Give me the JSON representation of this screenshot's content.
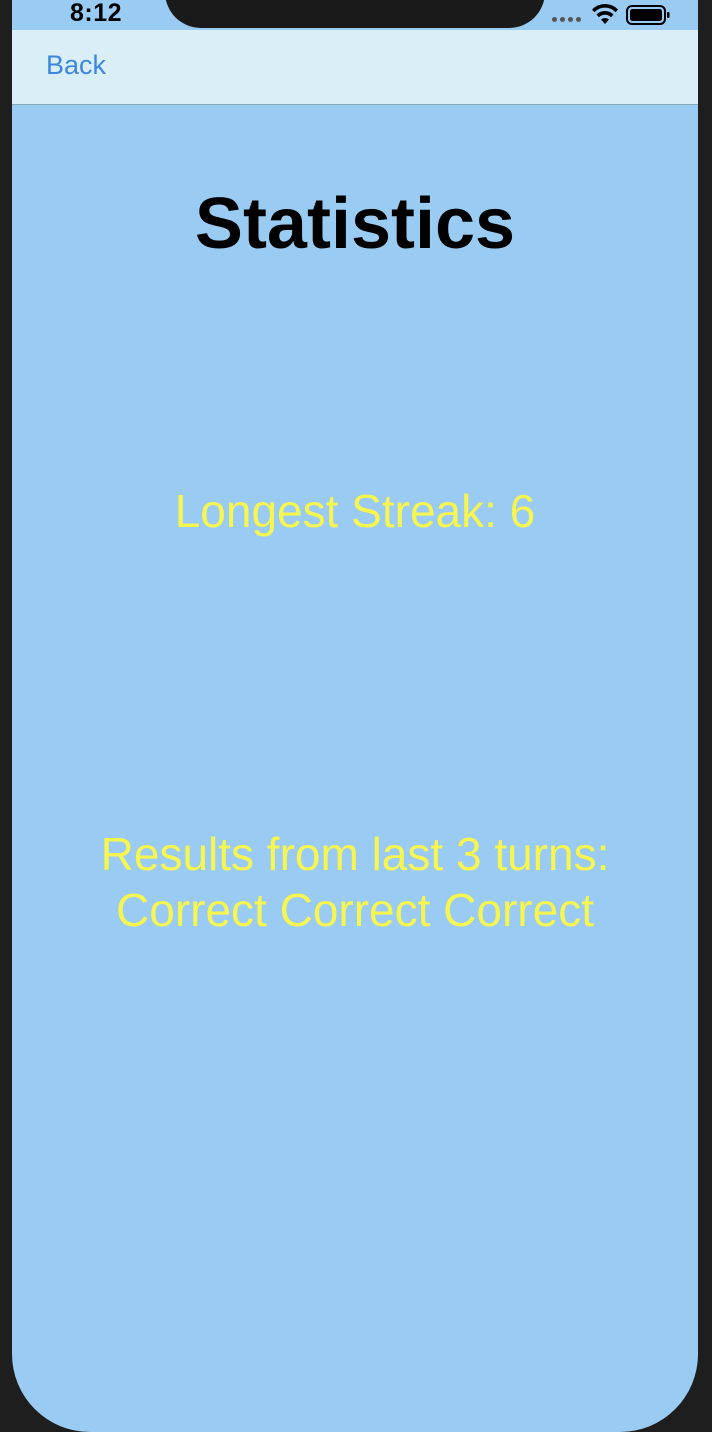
{
  "status_bar": {
    "time": "8:12"
  },
  "nav": {
    "back_label": "Back"
  },
  "main": {
    "title": "Statistics",
    "longest_streak": "Longest Streak: 6",
    "results_heading": "Results from last 3 turns:",
    "results_values": "Correct Correct Correct"
  },
  "colors": {
    "background": "#99cbf3",
    "nav_background": "#daeef7",
    "accent": "#3d86dd",
    "stat_text": "#f7f54f",
    "title_text": "#000000"
  },
  "icons": {
    "signal": "cellular-signal-icon",
    "wifi": "wifi-icon",
    "battery": "battery-icon"
  }
}
